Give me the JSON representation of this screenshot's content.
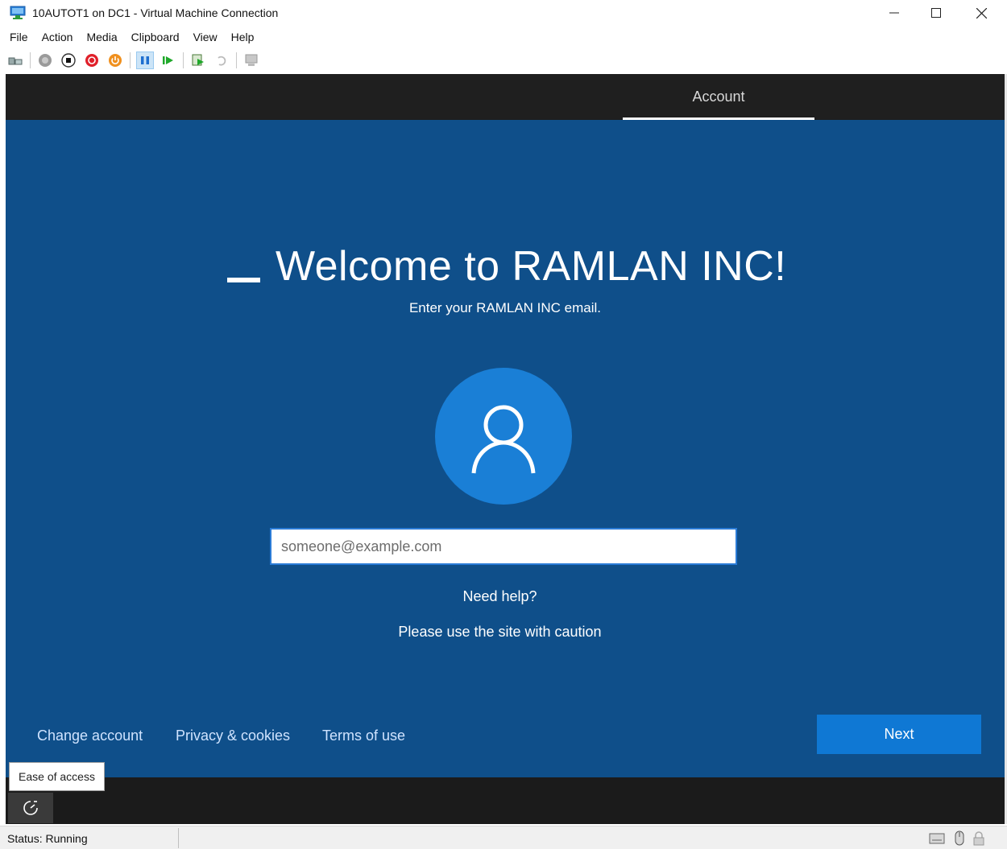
{
  "window": {
    "title": "10AUTOT1 on DC1 - Virtual Machine Connection"
  },
  "menu": [
    "File",
    "Action",
    "Media",
    "Clipboard",
    "View",
    "Help"
  ],
  "toolbar": {
    "icons": [
      "ctrl-alt-del-icon",
      "start-icon",
      "turn-off-icon",
      "shut-down-icon",
      "power-icon",
      "pause-icon",
      "resume-icon",
      "checkpoint-icon",
      "revert-icon",
      "enhanced-session-icon"
    ],
    "colors": {
      "red": "#e0202a",
      "orange": "#f0901e",
      "green": "#1fa82a",
      "blue": "#1e6fd0"
    }
  },
  "vm": {
    "top_tab": "Account",
    "welcome_title": "Welcome to RAMLAN INC!",
    "subtitle": "Enter your RAMLAN INC email.",
    "email_placeholder": "someone@example.com",
    "email_value": "",
    "need_help": "Need help?",
    "caution": "Please use the site with caution",
    "footer_links": [
      "Change account",
      "Privacy & cookies",
      "Terms of use"
    ],
    "next_label": "Next",
    "ease_tooltip": "Ease of access",
    "colors": {
      "background": "#0f4f8a",
      "accent": "#0f78d4",
      "avatar": "#1a7fd6"
    }
  },
  "status": {
    "text": "Status: Running"
  }
}
